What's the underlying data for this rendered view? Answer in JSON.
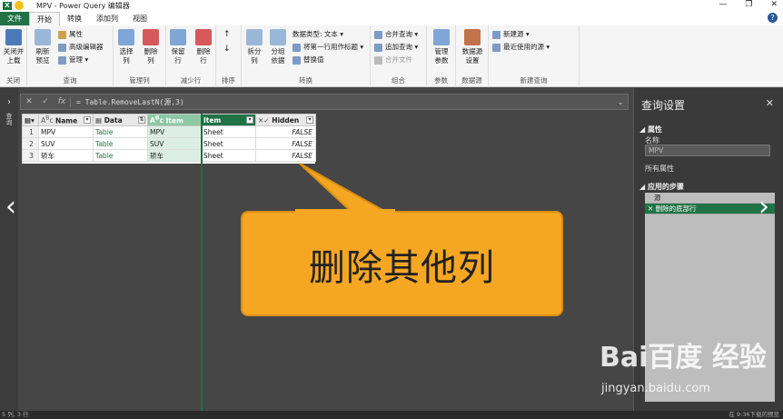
{
  "window": {
    "title": "MPV - Power Query 编辑器",
    "app_icon": "excel-icon",
    "minimize": "—",
    "restore": "❐",
    "close": "✕"
  },
  "tabs": [
    "文件",
    "开始",
    "转换",
    "添加列",
    "视图"
  ],
  "active_tab": "开始",
  "ribbon": {
    "close_group": {
      "btn": "关闭并\n上载",
      "label": "关闭"
    },
    "query_group": {
      "refresh": "刷新\n预览",
      "properties": "属性",
      "advanced": "高级编辑器",
      "manage": "管理",
      "label": "查询"
    },
    "manage_columns": {
      "choose": "选择\n列",
      "remove": "删除\n列",
      "label": "管理列"
    },
    "reduce_rows": {
      "keep": "保留\n行",
      "remove": "删除\n行",
      "label": "减少行"
    },
    "sort": {
      "label": "排序"
    },
    "transform": {
      "split": "拆分\n列",
      "group": "分组\n依据",
      "datatype": "数据类型: 文本",
      "firstrow": "将第一行用作标题",
      "replace": "替换值",
      "label": "转换"
    },
    "combine": {
      "merge": "合并查询",
      "append": "追加查询",
      "combine_files": "合并文件",
      "label": "组合"
    },
    "params": {
      "manage": "管理\n参数",
      "label": "参数"
    },
    "datasource": {
      "settings": "数据源\n设置",
      "label": "数据源"
    },
    "newquery": {
      "new_source": "新建源",
      "recent": "最近使用的源",
      "label": "新建查询"
    }
  },
  "left_strip": {
    "label": "查询"
  },
  "formula_bar": {
    "cancel": "✕",
    "confirm": "✓",
    "fx": "fx",
    "formula": "= Table.RemoveLastN(源,3)"
  },
  "grid": {
    "columns": [
      {
        "name": "Name",
        "type": "ABC"
      },
      {
        "name": "Data",
        "type": "table"
      },
      {
        "name": "Item",
        "type": "ABC"
      },
      {
        "name": "Item",
        "type": "ABC"
      },
      {
        "name": "Hidden",
        "type": "bool"
      }
    ],
    "rows": [
      {
        "n": "1",
        "name": "MPV",
        "data": "Table",
        "item": "MPV",
        "kind": "Sheet",
        "hidden": "FALSE"
      },
      {
        "n": "2",
        "name": "SUV",
        "data": "Table",
        "item": "SUV",
        "kind": "Sheet",
        "hidden": "FALSE"
      },
      {
        "n": "3",
        "name": "轿车",
        "data": "Table",
        "item": "轿车",
        "kind": "Sheet",
        "hidden": "FALSE"
      }
    ]
  },
  "callout": {
    "text": "删除其他列"
  },
  "query_settings": {
    "title": "查询设置",
    "close": "✕",
    "properties_header": "属性",
    "name_label": "名称",
    "name_value": "MPV",
    "all_properties": "所有属性",
    "applied_steps_header": "应用的步骤",
    "steps": [
      "源",
      "删除的底部行"
    ]
  },
  "status": {
    "left": "5 列, 3 行",
    "right": "在 9:36下载的预览"
  },
  "watermark": {
    "logo": "Bai百度 经验",
    "url": "jingyan.baidu.com"
  },
  "colors": {
    "accent": "#217346",
    "callout": "#f5a623"
  }
}
